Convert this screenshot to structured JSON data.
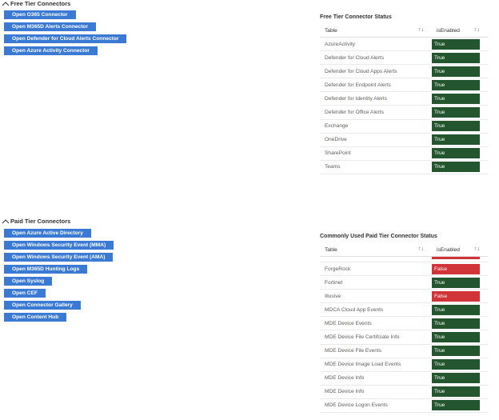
{
  "free": {
    "header": "Free Tier Connectors",
    "buttons": [
      "Open O365 Connector",
      "Open M365D Alerts Connector",
      "Open Defender for Cloud Alerts Connector",
      "Open Azure Activity Connector"
    ],
    "status": {
      "title": "Free Tier Connector Status",
      "col_table": "Table",
      "col_enabled": "isEnabled",
      "rows": [
        {
          "name": "AzureActivity",
          "value": "True"
        },
        {
          "name": "Defender for Cloud Alerts",
          "value": "True"
        },
        {
          "name": "Defender for Cloud Apps Alerts",
          "value": "True"
        },
        {
          "name": "Defender for Endpoint Alerts",
          "value": "True"
        },
        {
          "name": "Defender for Identity Alerts",
          "value": "True"
        },
        {
          "name": "Defender for Office Alerts",
          "value": "True"
        },
        {
          "name": "Exchange",
          "value": "True"
        },
        {
          "name": "OneDrive",
          "value": "True"
        },
        {
          "name": "SharePoint",
          "value": "True"
        },
        {
          "name": "Teams",
          "value": "True"
        }
      ]
    }
  },
  "paid": {
    "header": "Paid Tier Connectors",
    "buttons": [
      "Open Azure Active Directory",
      "Open Windows Security Event (MMA)",
      "Open Windows Security Event (AMA)",
      "Open M365D Hunting Logs",
      "Open Syslog",
      "Open CEF",
      "Open Connector Gallery",
      "Open Content Hub"
    ],
    "status": {
      "title": "Commonly Used Paid Tier Connector Status",
      "col_table": "Table",
      "col_enabled": "isEnabled",
      "rows": [
        {
          "name": "ForgeRock",
          "value": "False"
        },
        {
          "name": "Fortinet",
          "value": "True"
        },
        {
          "name": "Illusive",
          "value": "False"
        },
        {
          "name": "MDCA Cloud App Events",
          "value": "True"
        },
        {
          "name": "MDE Device Events",
          "value": "True"
        },
        {
          "name": "MDE Device File Certifciate Info",
          "value": "True"
        },
        {
          "name": "MDE Device File Events",
          "value": "True"
        },
        {
          "name": "MDE Device Image Load Events",
          "value": "True"
        },
        {
          "name": "MDE Device Info",
          "value": "True"
        },
        {
          "name": "MDE Device Info",
          "value": "True"
        },
        {
          "name": "MDE Device Logon Events",
          "value": "True"
        }
      ]
    }
  },
  "icons": {
    "collapse": "chevron-up-icon",
    "sort": "sort-arrows-icon"
  },
  "colors": {
    "button": "#3a79d4",
    "true": "#23562e",
    "false": "#d13438"
  }
}
